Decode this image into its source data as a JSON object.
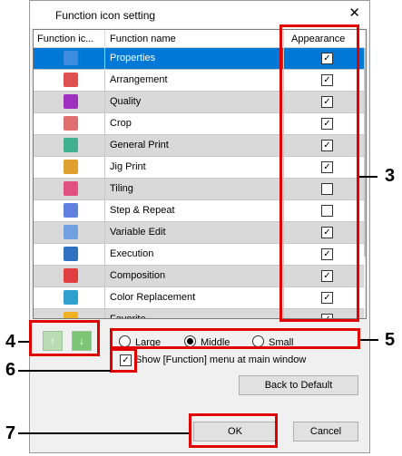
{
  "dialog": {
    "title": "Function icon setting",
    "close_glyph": "✕"
  },
  "table": {
    "headers": {
      "icon": "Function ic...",
      "name": "Function name",
      "appearance": "Appearance"
    },
    "rows": [
      {
        "name": "Properties",
        "checked": true,
        "icon": "info-icon",
        "icon_color": "#3c8de0"
      },
      {
        "name": "Arrangement",
        "checked": true,
        "icon": "arrangement-icon",
        "icon_color": "#e05050"
      },
      {
        "name": "Quality",
        "checked": true,
        "icon": "quality-icon",
        "icon_color": "#a030c0"
      },
      {
        "name": "Crop",
        "checked": true,
        "icon": "crop-icon",
        "icon_color": "#e07070"
      },
      {
        "name": "General Print",
        "checked": true,
        "icon": "general-print-icon",
        "icon_color": "#40b090"
      },
      {
        "name": "Jig Print",
        "checked": true,
        "icon": "jig-print-icon",
        "icon_color": "#e0a030"
      },
      {
        "name": "Tiling",
        "checked": false,
        "icon": "tiling-icon",
        "icon_color": "#e05080"
      },
      {
        "name": "Step & Repeat",
        "checked": false,
        "icon": "step-repeat-icon",
        "icon_color": "#6080e0"
      },
      {
        "name": "Variable Edit",
        "checked": true,
        "icon": "variable-edit-icon",
        "icon_color": "#70a0e0"
      },
      {
        "name": "Execution",
        "checked": true,
        "icon": "execution-icon",
        "icon_color": "#3070c0"
      },
      {
        "name": "Composition",
        "checked": true,
        "icon": "composition-icon",
        "icon_color": "#e04040"
      },
      {
        "name": "Color Replacement",
        "checked": true,
        "icon": "color-replacement-icon",
        "icon_color": "#30a0d0"
      },
      {
        "name": "Favorite",
        "checked": true,
        "icon": "favorite-icon",
        "icon_color": "#f0b020"
      }
    ],
    "selected_index": 0
  },
  "move_buttons": {
    "up_glyph": "↑",
    "down_glyph": "↓"
  },
  "size_options": {
    "large": "Large",
    "middle": "Middle",
    "small": "Small",
    "selected": "Middle"
  },
  "show_menu": {
    "label": "Show [Function] menu at main window",
    "checked": true
  },
  "buttons": {
    "back_to_default": "Back to Default",
    "ok": "OK",
    "cancel": "Cancel"
  },
  "callouts": {
    "c3": "3",
    "c4": "4",
    "c5": "5",
    "c6": "6",
    "c7": "7"
  },
  "colors": {
    "highlight": "#e00000",
    "selection": "#0078d7",
    "move_button": "#7cc576"
  }
}
